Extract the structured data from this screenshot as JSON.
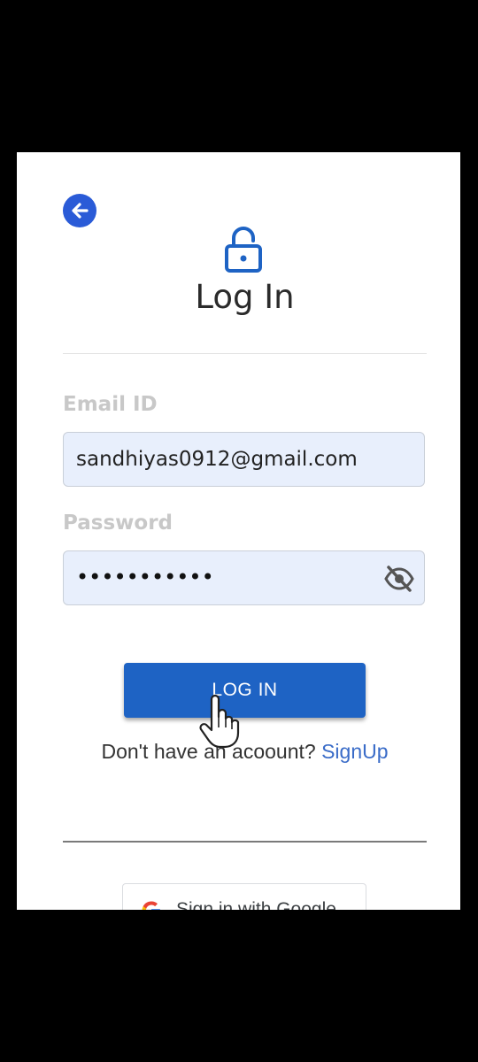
{
  "header": {
    "title": "Log In"
  },
  "form": {
    "email_label": "Email ID",
    "email_value": "sandhiyas0912@gmail.com",
    "password_label": "Password",
    "password_masked": "•••••••••••",
    "login_label": "LOG IN"
  },
  "signup": {
    "prompt": "Don't have an acoount? ",
    "link_label": "SignUp"
  },
  "google": {
    "label": "Sign in with Google"
  },
  "icons": {
    "back": "arrow-left-circle-icon",
    "lock": "unlock-icon",
    "eye": "eye-off-icon",
    "google": "google-g-icon",
    "cursor": "hand-pointer-icon"
  },
  "colors": {
    "accent": "#1e63c4",
    "back_button": "#2a5bd7",
    "field_bg": "#e8effc",
    "link": "#3a6cc8",
    "label": "#c8c8c8"
  }
}
